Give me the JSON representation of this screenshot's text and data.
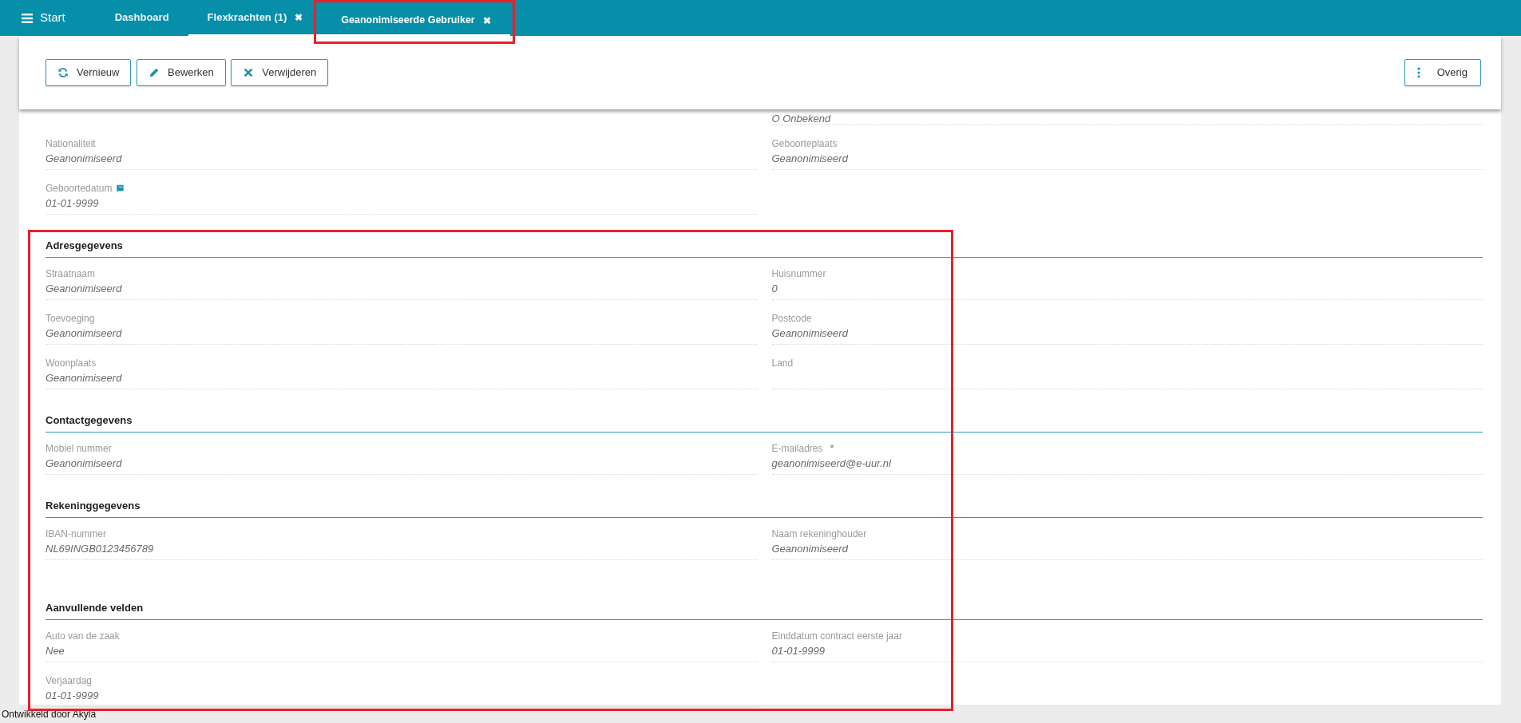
{
  "topbar": {
    "menu_label": "Start",
    "tabs": [
      {
        "label": "Dashboard",
        "selected": false,
        "underlined": false,
        "highlighted": false
      },
      {
        "label": "Flexkrachten (1)",
        "close": "✖",
        "selected": false,
        "underlined": true,
        "highlighted": false
      },
      {
        "label": "Geanonimiseerde Gebruiker",
        "close": "✖",
        "selected": true,
        "underlined": true,
        "highlighted": true
      }
    ]
  },
  "toolbar": {
    "buttons": [
      {
        "label": "Vernieuw"
      },
      {
        "label": "Bewerken"
      },
      {
        "label": "Verwijderen"
      }
    ],
    "right_button": {
      "label": "Overig"
    }
  },
  "sections": [
    {
      "rows": [
        {
          "right": {
            "value": "O Onbekend"
          }
        },
        {
          "left": {
            "label": "Nationaliteit",
            "value": "Geanonimiseerd"
          },
          "right": {
            "label": "Geboorteplaats",
            "value": "Geanonimiseerd"
          }
        },
        {
          "left": {
            "label": "Geboortedatum",
            "value": "01-01-9999",
            "kind": "noted"
          }
        }
      ]
    },
    {
      "title": "Adresgegevens",
      "highlighted": true,
      "rows": [
        {
          "left": {
            "label": "Straatnaam",
            "value": "Geanonimiseerd"
          },
          "right": {
            "label": "Huisnummer",
            "value": "0"
          }
        },
        {
          "left": {
            "label": "Toevoeging",
            "value": "Geanonimiseerd"
          },
          "right": {
            "label": "Postcode",
            "value": "Geanonimiseerd"
          }
        },
        {
          "left": {
            "label": "Woonplaats",
            "value": "Geanonimiseerd"
          },
          "right": {
            "label": "Land"
          }
        }
      ]
    },
    {
      "title": "Contactgegevens",
      "highlighted": true,
      "rows": [
        {
          "left": {
            "label": "Mobiel nummer",
            "value": "Geanonimiseerd"
          },
          "right": {
            "label": "E-mailadres",
            "required_mark": "*",
            "value": "geanonimiseerd@e-uur.nl"
          }
        }
      ]
    },
    {
      "title": "Rekeninggegevens",
      "highlighted": true,
      "rows": [
        {
          "left": {
            "label": "IBAN-nummer",
            "value": "NL69INGB0123456789"
          },
          "right": {
            "label": "Naam rekeninghouder",
            "value": "Geanonimiseerd"
          }
        },
        {}
      ]
    },
    {
      "title": "Aanvullende velden",
      "highlighted": true,
      "rows": [
        {
          "left": {
            "label": "Auto van de zaak",
            "value": "Nee"
          },
          "right": {
            "label": "Einddatum contract eerste jaar",
            "value": "01-01-9999"
          }
        },
        {
          "left": {
            "label": "Verjaardag",
            "value": "01-01-9999"
          }
        }
      ]
    }
  ],
  "footer": "Ontwikkeld door Akyla"
}
